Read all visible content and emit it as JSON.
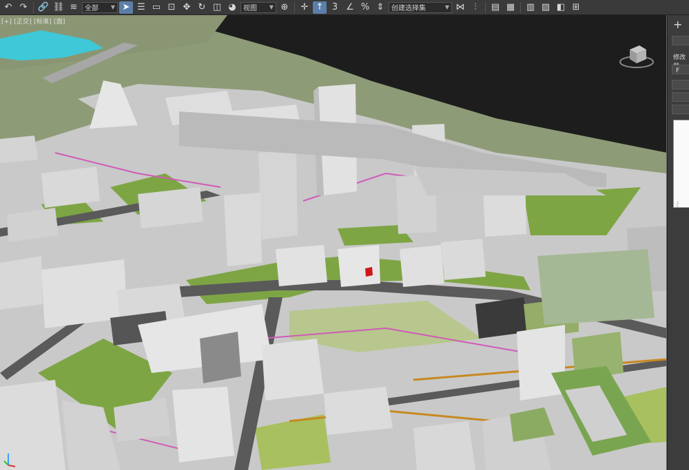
{
  "toolbar": {
    "filter_value": "全部",
    "refcoord_value": "视图",
    "selset_value": "创建选择集",
    "icons": [
      "undo-icon",
      "redo-icon",
      "link-icon",
      "unlink-icon",
      "bind-spacewarp-icon",
      "select-icon",
      "select-by-name-icon",
      "region-select-icon",
      "window-crossing-icon",
      "move-icon",
      "rotate-icon",
      "scale-icon",
      "pivot-icon",
      "snap-toggle-icon",
      "angle-snap-icon",
      "percent-snap-icon",
      "spinner-snap-icon",
      "mirror-icon",
      "align-icon",
      "layer-icon",
      "ribbon-icon",
      "material-editor-icon",
      "render-setup-icon",
      "render-frame-icon",
      "render-icon"
    ]
  },
  "viewport": {
    "label": "[+] [正交] [标准] [面]"
  },
  "command_panel": {
    "label_1": "修改器",
    "label_2": "F",
    "key_icon": "key-icon"
  },
  "colors": {
    "background": "#1d1d1d",
    "land": "#8f9c78",
    "grass": "#7ea544",
    "building": "#d8d8d8",
    "road": "#595959",
    "pink": "#d05ab8",
    "orange": "#c88820",
    "water": "#3ec8d8"
  }
}
